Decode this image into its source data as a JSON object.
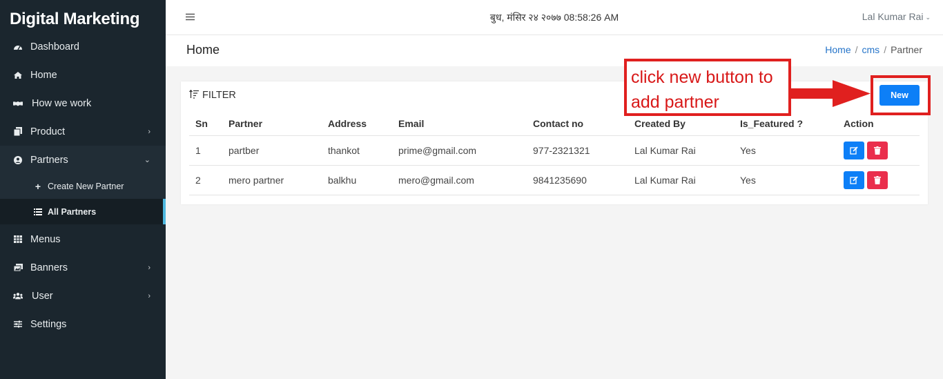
{
  "brand": "Digital Marketing",
  "sidebar": {
    "items": [
      {
        "label": "Dashboard",
        "icon": "dashboard-icon"
      },
      {
        "label": "Home",
        "icon": "home-icon"
      },
      {
        "label": "How we work",
        "icon": "handshake-icon"
      },
      {
        "label": "Product",
        "icon": "copy-icon",
        "chevron": "›"
      },
      {
        "label": "Partners",
        "icon": "user-circle-icon",
        "chevron": "⌄"
      },
      {
        "label": "Menus",
        "icon": "grid-icon"
      },
      {
        "label": "Banners",
        "icon": "images-icon",
        "chevron": "›"
      },
      {
        "label": "User",
        "icon": "users-icon",
        "chevron": "›"
      },
      {
        "label": "Settings",
        "icon": "sliders-icon"
      }
    ],
    "sub_items": [
      {
        "label": "Create New Partner",
        "icon": "plus-icon"
      },
      {
        "label": "All Partners",
        "icon": "list-icon"
      }
    ]
  },
  "topbar": {
    "datetime": "बुध, मंसिर २४ २०७७ 08:58:26 AM",
    "user": "Lal Kumar Rai",
    "caret": "⌄"
  },
  "page": {
    "title": "Home",
    "breadcrumb": [
      "Home",
      "cms",
      "Partner"
    ],
    "sep": "/"
  },
  "card": {
    "filter_label": "FILTER",
    "new_button": "New"
  },
  "table": {
    "headers": [
      "Sn",
      "Partner",
      "Address",
      "Email",
      "Contact no",
      "Created By",
      "Is_Featured ?",
      "Action"
    ],
    "rows": [
      {
        "sn": "1",
        "partner": "partber",
        "address": "thankot",
        "email": "prime@gmail.com",
        "contact": "977-2321321",
        "created_by": "Lal Kumar Rai",
        "featured": "Yes"
      },
      {
        "sn": "2",
        "partner": "mero partner",
        "address": "balkhu",
        "email": "mero@gmail.com",
        "contact": "9841235690",
        "created_by": "Lal Kumar Rai",
        "featured": "Yes"
      }
    ]
  },
  "annotation": {
    "line1": "click new button to",
    "line2": "add partner",
    "color": "#e0201f"
  },
  "colors": {
    "sidebar_bg": "#1b262e",
    "primary": "#0d7ff7",
    "danger": "#ea2e4c",
    "link": "#2574c9"
  }
}
